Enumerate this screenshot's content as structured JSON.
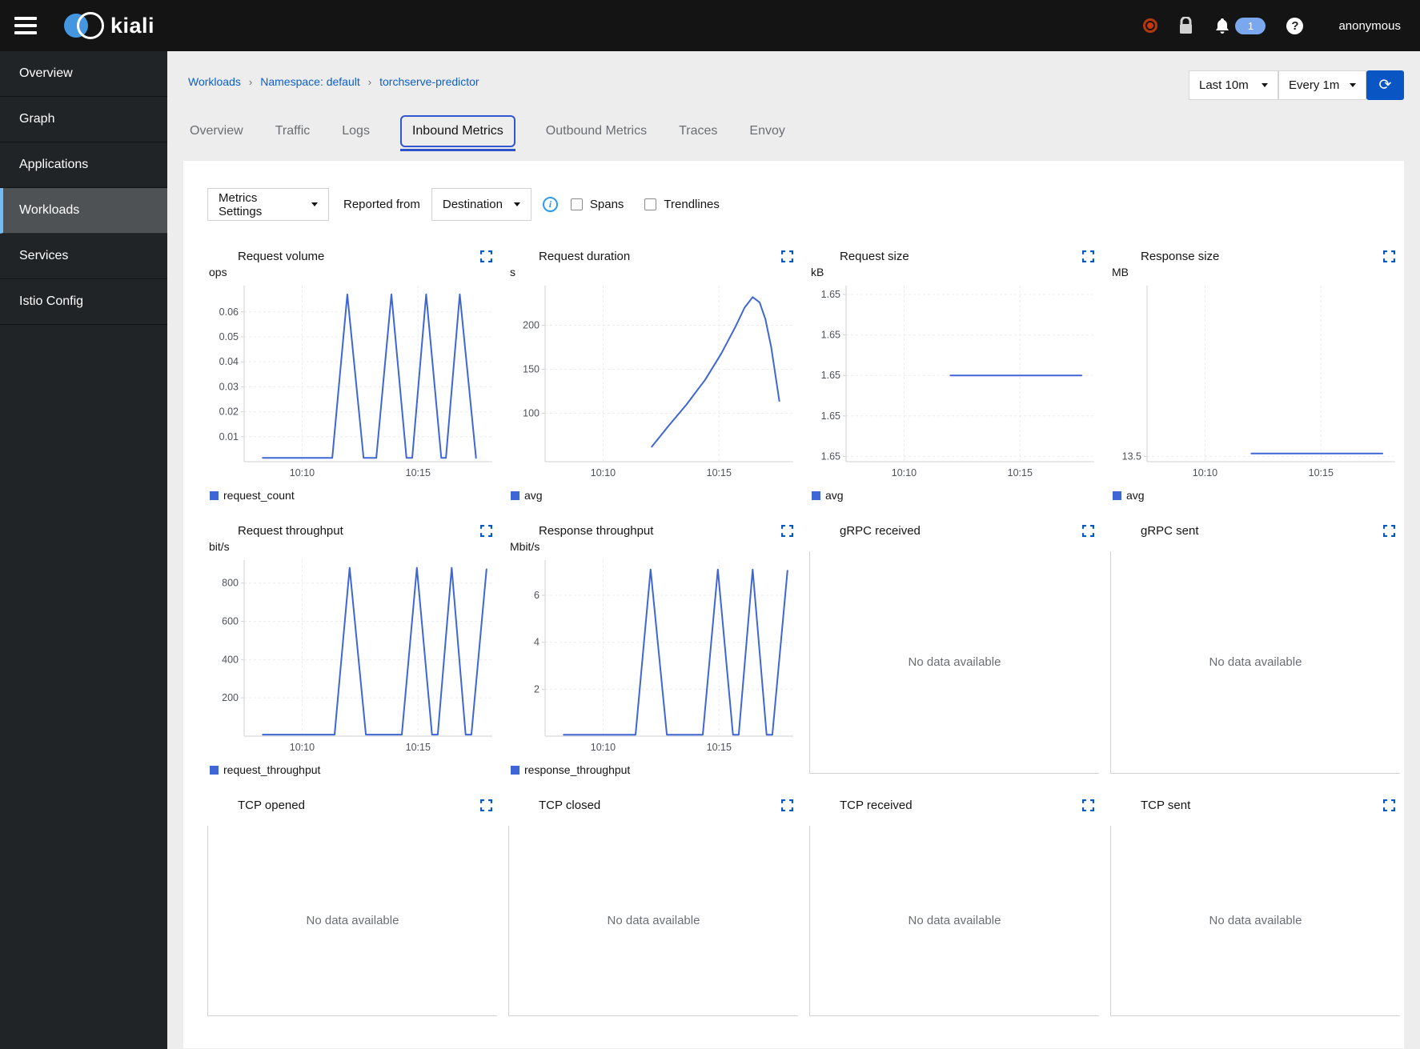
{
  "header": {
    "brand": "kiali",
    "user": "anonymous",
    "notification_count": "1"
  },
  "sidebar": {
    "items": [
      {
        "label": "Overview",
        "active": false
      },
      {
        "label": "Graph",
        "active": false
      },
      {
        "label": "Applications",
        "active": false
      },
      {
        "label": "Workloads",
        "active": true
      },
      {
        "label": "Services",
        "active": false
      },
      {
        "label": "Istio Config",
        "active": false
      }
    ]
  },
  "breadcrumb": {
    "items": [
      "Workloads",
      "Namespace: default",
      "torchserve-predictor"
    ]
  },
  "toolbar": {
    "time_range": "Last 10m",
    "refresh_interval": "Every 1m",
    "refresh_icon": "⟳"
  },
  "tabs": [
    {
      "label": "Overview",
      "active": false
    },
    {
      "label": "Traffic",
      "active": false
    },
    {
      "label": "Logs",
      "active": false
    },
    {
      "label": "Inbound Metrics",
      "active": true
    },
    {
      "label": "Outbound Metrics",
      "active": false
    },
    {
      "label": "Traces",
      "active": false
    },
    {
      "label": "Envoy",
      "active": false
    }
  ],
  "controls": {
    "metrics_settings_label": "Metrics Settings",
    "reported_from_label": "Reported from",
    "reported_from_value": "Destination",
    "spans_label": "Spans",
    "trendlines_label": "Trendlines"
  },
  "no_data_text": "No data available",
  "colors": {
    "chart_line": "#3e66d4",
    "grid": "#ececec",
    "axis": "#d2d2d2",
    "tick_text": "#4d5258",
    "accent_blue": "#0a55c4"
  },
  "chart_data": [
    {
      "type": "line",
      "title": "Request volume",
      "unit": "ops",
      "xlim": [
        607.5,
        618.2
      ],
      "xticks": [
        {
          "v": 610,
          "label": "10:10"
        },
        {
          "v": 615,
          "label": "10:15"
        }
      ],
      "ylim": [
        0,
        0.0705
      ],
      "yticks": [
        {
          "v": 0.01,
          "label": "0.01"
        },
        {
          "v": 0.02,
          "label": "0.02"
        },
        {
          "v": 0.03,
          "label": "0.03"
        },
        {
          "v": 0.04,
          "label": "0.04"
        },
        {
          "v": 0.05,
          "label": "0.05"
        },
        {
          "v": 0.06,
          "label": "0.06"
        }
      ],
      "series": [
        {
          "name": "request_count",
          "points": [
            [
              608.3,
              0.0015
            ],
            [
              611.3,
              0.0015
            ],
            [
              611.95,
              0.067
            ],
            [
              612.65,
              0.0015
            ],
            [
              613.2,
              0.0015
            ],
            [
              613.85,
              0.067
            ],
            [
              614.5,
              0.0015
            ],
            [
              614.75,
              0.0015
            ],
            [
              615.35,
              0.067
            ],
            [
              616.0,
              0.0015
            ],
            [
              616.2,
              0.0015
            ],
            [
              616.8,
              0.067
            ],
            [
              617.5,
              0.0015
            ]
          ]
        }
      ]
    },
    {
      "type": "line",
      "title": "Request duration",
      "unit": "s",
      "xlim": [
        607.5,
        618.2
      ],
      "xticks": [
        {
          "v": 610,
          "label": "10:10"
        },
        {
          "v": 615,
          "label": "10:15"
        }
      ],
      "ylim": [
        45,
        245
      ],
      "yticks": [
        {
          "v": 100,
          "label": "100"
        },
        {
          "v": 150,
          "label": "150"
        },
        {
          "v": 200,
          "label": "200"
        }
      ],
      "series": [
        {
          "name": "avg",
          "points": [
            [
              612.1,
              62
            ],
            [
              612.8,
              85
            ],
            [
              613.6,
              110
            ],
            [
              614.4,
              138
            ],
            [
              615.1,
              168
            ],
            [
              615.7,
              198
            ],
            [
              616.1,
              220
            ],
            [
              616.45,
              232
            ],
            [
              616.75,
              226
            ],
            [
              617.0,
              207
            ],
            [
              617.25,
              175
            ],
            [
              617.45,
              140
            ],
            [
              617.6,
              114
            ]
          ]
        }
      ]
    },
    {
      "type": "line",
      "title": "Request size",
      "unit": "kB",
      "xlim": [
        607.5,
        618.2
      ],
      "xticks": [
        {
          "v": 610,
          "label": "10:10"
        },
        {
          "v": 615,
          "label": "10:15"
        }
      ],
      "ylim": [
        0,
        1
      ],
      "yticks": [
        {
          "v": 0.95,
          "label": "1.65"
        },
        {
          "v": 0.72,
          "label": "1.65"
        },
        {
          "v": 0.49,
          "label": "1.65"
        },
        {
          "v": 0.26,
          "label": "1.65"
        },
        {
          "v": 0.03,
          "label": "1.65"
        }
      ],
      "series": [
        {
          "name": "avg",
          "points": [
            [
              612.0,
              0.49
            ],
            [
              617.65,
              0.49
            ]
          ]
        }
      ]
    },
    {
      "type": "line",
      "title": "Response size",
      "unit": "MB",
      "xlim": [
        607.5,
        618.2
      ],
      "xticks": [
        {
          "v": 610,
          "label": "10:10"
        },
        {
          "v": 615,
          "label": "10:15"
        }
      ],
      "ylim": [
        0,
        1
      ],
      "yticks": [
        {
          "v": 0.03,
          "label": "13.5"
        }
      ],
      "series": [
        {
          "name": "avg",
          "points": [
            [
              612.0,
              0.047
            ],
            [
              617.65,
              0.047
            ]
          ]
        }
      ]
    },
    {
      "type": "line",
      "title": "Request throughput",
      "unit": "bit/s",
      "xlim": [
        607.5,
        618.2
      ],
      "xticks": [
        {
          "v": 610,
          "label": "10:10"
        },
        {
          "v": 615,
          "label": "10:15"
        }
      ],
      "ylim": [
        0,
        920
      ],
      "yticks": [
        {
          "v": 200,
          "label": "200"
        },
        {
          "v": 400,
          "label": "400"
        },
        {
          "v": 600,
          "label": "600"
        },
        {
          "v": 800,
          "label": "800"
        }
      ],
      "series": [
        {
          "name": "request_throughput",
          "points": [
            [
              608.3,
              8
            ],
            [
              611.4,
              8
            ],
            [
              612.05,
              880
            ],
            [
              612.75,
              8
            ],
            [
              614.3,
              8
            ],
            [
              614.95,
              880
            ],
            [
              615.6,
              8
            ],
            [
              615.85,
              8
            ],
            [
              616.45,
              880
            ],
            [
              617.05,
              8
            ],
            [
              617.3,
              8
            ],
            [
              617.95,
              872
            ]
          ]
        }
      ]
    },
    {
      "type": "line",
      "title": "Response throughput",
      "unit": "Mbit/s",
      "xlim": [
        607.5,
        618.2
      ],
      "xticks": [
        {
          "v": 610,
          "label": "10:10"
        },
        {
          "v": 615,
          "label": "10:15"
        }
      ],
      "ylim": [
        0,
        7.5
      ],
      "yticks": [
        {
          "v": 2,
          "label": "2"
        },
        {
          "v": 4,
          "label": "4"
        },
        {
          "v": 6,
          "label": "6"
        }
      ],
      "series": [
        {
          "name": "response_throughput",
          "points": [
            [
              608.3,
              0.06
            ],
            [
              611.4,
              0.06
            ],
            [
              612.05,
              7.1
            ],
            [
              612.75,
              0.06
            ],
            [
              614.3,
              0.06
            ],
            [
              614.95,
              7.1
            ],
            [
              615.6,
              0.06
            ],
            [
              615.85,
              0.06
            ],
            [
              616.45,
              7.1
            ],
            [
              617.05,
              0.06
            ],
            [
              617.3,
              0.06
            ],
            [
              617.95,
              7.05
            ]
          ]
        }
      ]
    },
    {
      "type": "empty",
      "title": "gRPC received"
    },
    {
      "type": "empty",
      "title": "gRPC sent"
    },
    {
      "type": "empty",
      "title": "TCP opened"
    },
    {
      "type": "empty",
      "title": "TCP closed"
    },
    {
      "type": "empty",
      "title": "TCP received"
    },
    {
      "type": "empty",
      "title": "TCP sent"
    }
  ]
}
